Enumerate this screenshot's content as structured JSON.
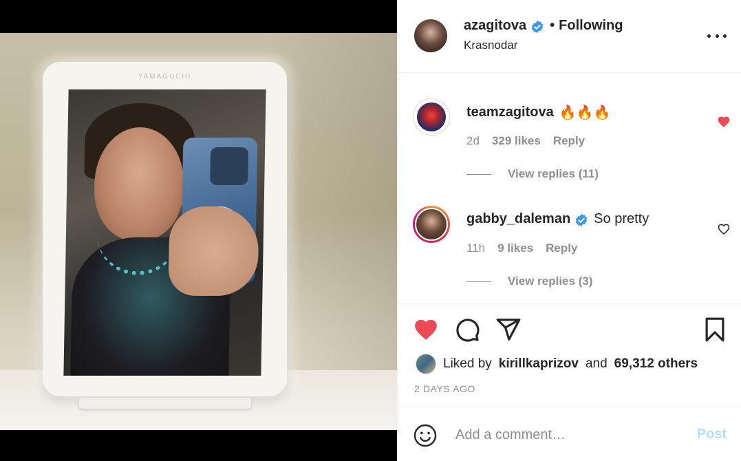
{
  "post": {
    "username": "azagitova",
    "verified": true,
    "follow_separator": "•",
    "follow_state": "Following",
    "location": "Krasnodar",
    "image": {
      "mirror_brand": "YAMAGUCHI"
    }
  },
  "comments": [
    {
      "username": "teamzagitova",
      "text": "🔥🔥🔥",
      "age": "2d",
      "likes": "329 likes",
      "reply_label": "Reply",
      "view_replies": "View replies (11)",
      "liked": true
    },
    {
      "username": "gabby_daleman",
      "verified": true,
      "text": "So pretty",
      "age": "11h",
      "likes": "9 likes",
      "reply_label": "Reply",
      "view_replies": "View replies (3)",
      "liked": false
    }
  ],
  "actions": {
    "liked_by_prefix": "Liked by",
    "liked_by_user": "kirillkaprizov",
    "liked_by_and": "and",
    "liked_by_others": "69,312 others",
    "timestamp": "2 DAYS AGO"
  },
  "add_comment": {
    "placeholder": "Add a comment…",
    "post_label": "Post"
  },
  "colors": {
    "like_red": "#ed4956",
    "verified_blue": "#3897f0",
    "post_disabled": "#b2dffc",
    "muted_text": "#8e8e8e"
  }
}
